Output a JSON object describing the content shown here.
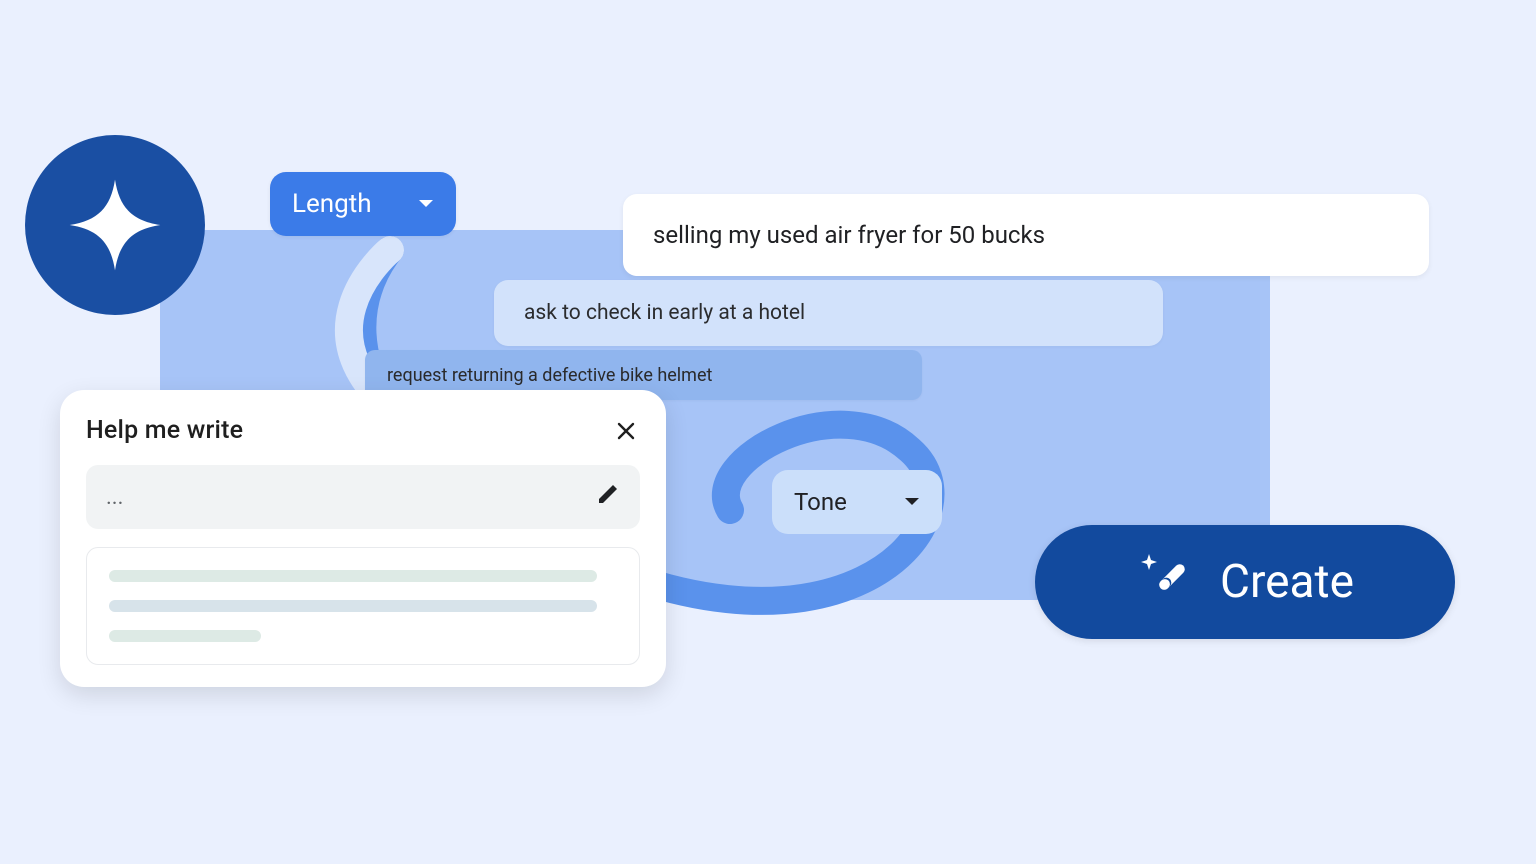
{
  "length_dropdown": {
    "label": "Length"
  },
  "tone_dropdown": {
    "label": "Tone"
  },
  "prompts": {
    "p1": "selling my used air fryer for 50 bucks",
    "p2": "ask to check in early at a hotel",
    "p3": "request returning a defective bike helmet"
  },
  "help_me_write": {
    "title": "Help me write",
    "input_placeholder": "..."
  },
  "create_button": {
    "label": "Create"
  },
  "icons": {
    "sparkle": "sparkle-icon",
    "close": "close-icon",
    "pencil": "pencil-icon",
    "wand": "wand-sparkle-icon",
    "caret_down": "chevron-down-icon"
  }
}
